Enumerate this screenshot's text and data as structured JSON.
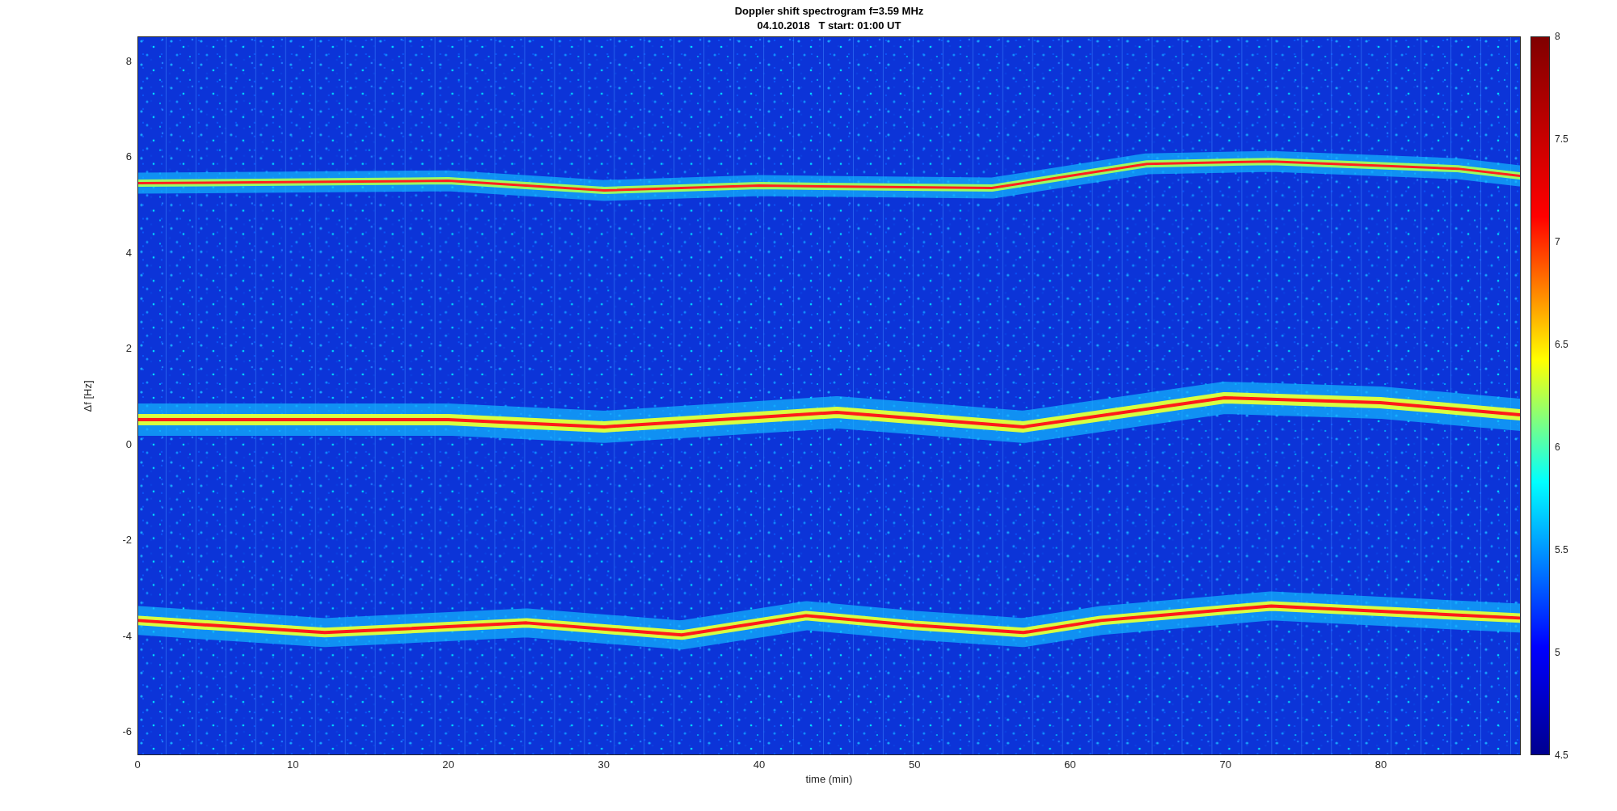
{
  "figure": {
    "title_lines": [
      "Doppler shift spectrogram f=3.59 MHz",
      "04.10.2018   T start: 01:00 UT"
    ],
    "x_axis": {
      "label": "time (min)",
      "ticks": [
        "0",
        "10",
        "20",
        "30",
        "40",
        "50",
        "60",
        "70",
        "80"
      ]
    },
    "y_axis": {
      "label": "Δf [Hz]",
      "ticks": [
        "8",
        "6",
        "4",
        "2",
        "0",
        "-2",
        "-4",
        "-6"
      ]
    },
    "colorbar": {
      "ticks": [
        "8",
        "7.5",
        "7",
        "6.5",
        "6",
        "5.5",
        "5",
        "4.5"
      ]
    }
  }
}
